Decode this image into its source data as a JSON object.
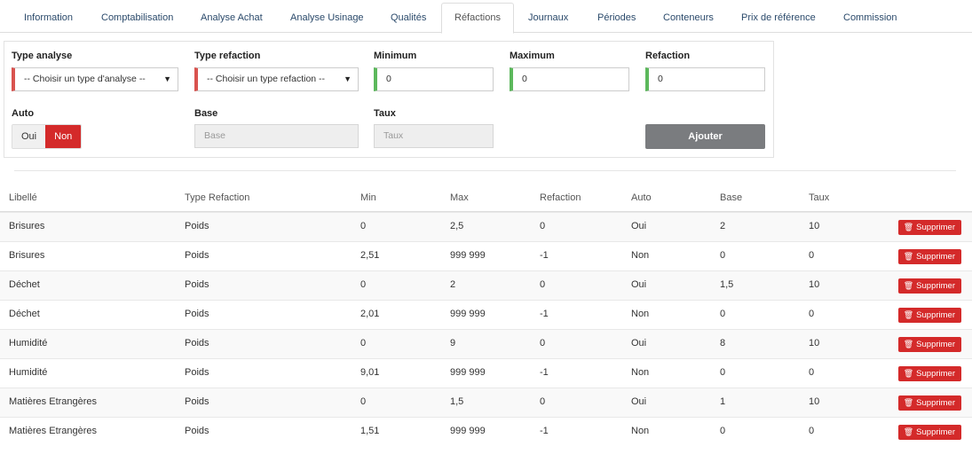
{
  "tabs": [
    {
      "label": "Information"
    },
    {
      "label": "Comptabilisation"
    },
    {
      "label": "Analyse Achat"
    },
    {
      "label": "Analyse Usinage"
    },
    {
      "label": "Qualités"
    },
    {
      "label": "Réfactions",
      "active": true
    },
    {
      "label": "Journaux"
    },
    {
      "label": "Périodes"
    },
    {
      "label": "Conteneurs"
    },
    {
      "label": "Prix de référence"
    },
    {
      "label": "Commission"
    }
  ],
  "form": {
    "type_analyse": {
      "label": "Type analyse",
      "value": "-- Choisir un type d'analyse --"
    },
    "type_refaction": {
      "label": "Type refaction",
      "value": "-- Choisir un type refaction --"
    },
    "minimum": {
      "label": "Minimum",
      "value": "0"
    },
    "maximum": {
      "label": "Maximum",
      "value": "0"
    },
    "refaction": {
      "label": "Refaction",
      "value": "0"
    },
    "auto": {
      "label": "Auto",
      "yes": "Oui",
      "no": "Non",
      "selected": "Non"
    },
    "base": {
      "label": "Base",
      "placeholder": "Base"
    },
    "taux": {
      "label": "Taux",
      "placeholder": "Taux"
    },
    "add_button": "Ajouter"
  },
  "table": {
    "headers": [
      "Libellé",
      "Type Refaction",
      "Min",
      "Max",
      "Refaction",
      "Auto",
      "Base",
      "Taux"
    ],
    "delete_label": "Supprimer",
    "rows": [
      [
        "Brisures",
        "Poids",
        "0",
        "2,5",
        "0",
        "Oui",
        "2",
        "10"
      ],
      [
        "Brisures",
        "Poids",
        "2,51",
        "999 999",
        "-1",
        "Non",
        "0",
        "0"
      ],
      [
        "Déchet",
        "Poids",
        "0",
        "2",
        "0",
        "Oui",
        "1,5",
        "10"
      ],
      [
        "Déchet",
        "Poids",
        "2,01",
        "999 999",
        "-1",
        "Non",
        "0",
        "0"
      ],
      [
        "Humidité",
        "Poids",
        "0",
        "9",
        "0",
        "Oui",
        "8",
        "10"
      ],
      [
        "Humidité",
        "Poids",
        "9,01",
        "999 999",
        "-1",
        "Non",
        "0",
        "0"
      ],
      [
        "Matières Etrangères",
        "Poids",
        "0",
        "1,5",
        "0",
        "Oui",
        "1",
        "10"
      ],
      [
        "Matières Etrangères",
        "Poids",
        "1,51",
        "999 999",
        "-1",
        "Non",
        "0",
        "0"
      ]
    ]
  },
  "colors": {
    "danger": "#d42a2a",
    "required": "#d9534f",
    "valid": "#5cb85c",
    "button": "#7a7c7f"
  },
  "icons": {
    "delete": "trash-icon",
    "select": "caret-down-icon"
  }
}
